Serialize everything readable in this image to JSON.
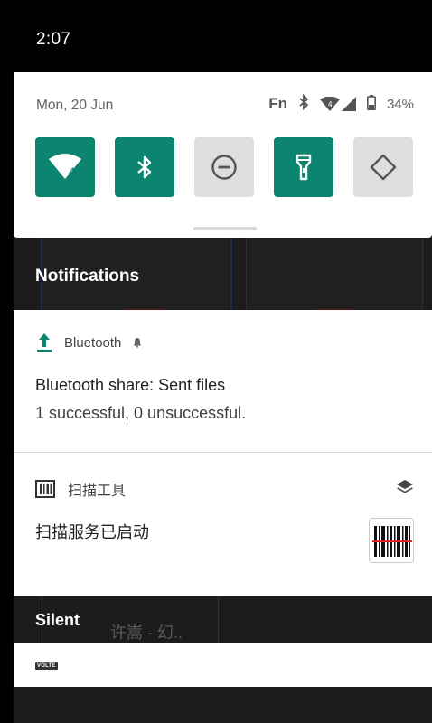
{
  "status_bar": {
    "time": "2:07"
  },
  "quick_settings": {
    "date": "Mon, 20 Jun",
    "status": {
      "fn_label": "Fn",
      "battery": "34%",
      "wifi_badge": "4"
    },
    "tiles": [
      {
        "name": "wifi",
        "icon": "wifi-icon",
        "state": "on",
        "badge": "4"
      },
      {
        "name": "bluetooth",
        "icon": "bluetooth-icon",
        "state": "on"
      },
      {
        "name": "do-not-disturb",
        "icon": "do-not-disturb-icon",
        "state": "off"
      },
      {
        "name": "flashlight",
        "icon": "flashlight-icon",
        "state": "on"
      },
      {
        "name": "auto-rotate",
        "icon": "auto-rotate-icon",
        "state": "off"
      }
    ],
    "accent_color": "#0b8470"
  },
  "notifications": {
    "header": "Notifications",
    "bluetooth": {
      "app_name": "Bluetooth",
      "title": "Bluetooth share: Sent files",
      "text": "1 successful, 0 unsuccessful."
    },
    "scanner": {
      "app_name": "扫描工具",
      "text": "扫描服务已启动"
    }
  },
  "silent": {
    "header": "Silent",
    "badge": "VOLTE"
  },
  "background": {
    "music_text": "许嵩 - 幻.."
  }
}
